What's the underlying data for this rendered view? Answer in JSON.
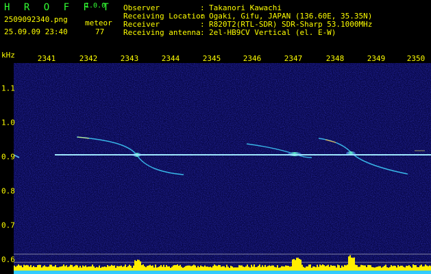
{
  "header": {
    "brand": "H R O F F T",
    "version": "1.0.0",
    "filename": "2509092340.png",
    "datetime": "25.09.09 23:40",
    "meteor_label": "meteor",
    "meteor_count": "77",
    "info_rows": [
      {
        "key": "Observer",
        "sep": ":",
        "value": "Takanori Kawachi"
      },
      {
        "key": "Receiving Location",
        "sep": ":",
        "value": "Ogaki, Gifu, JAPAN (136.60E, 35.35N)"
      },
      {
        "key": "Receiver",
        "sep": ":",
        "value": "R820T2(RTL-SDR) SDR-Sharp 53.1000MHz"
      },
      {
        "key": "Receiving antenna",
        "sep": ":",
        "value": "2el-HB9CV Vertical (el. E-W)"
      }
    ]
  },
  "axes": {
    "y_unit": "kHz",
    "x_ticks": [
      "2341",
      "2342",
      "2343",
      "2344",
      "2345",
      "2346",
      "2347",
      "2348",
      "2349",
      "2350"
    ],
    "y_ticks": [
      "1.1",
      "1.0",
      "0.9",
      "0.8",
      "0.7",
      "0.6"
    ]
  },
  "colors": {
    "text_yellow": "#ffff00",
    "brand_green": "#33ff33",
    "background_blue": "#0a0a55",
    "carrier_line": "#9fe8ff",
    "bar_yellow": "#ffee00",
    "bar_cyan": "#33ccff"
  }
}
